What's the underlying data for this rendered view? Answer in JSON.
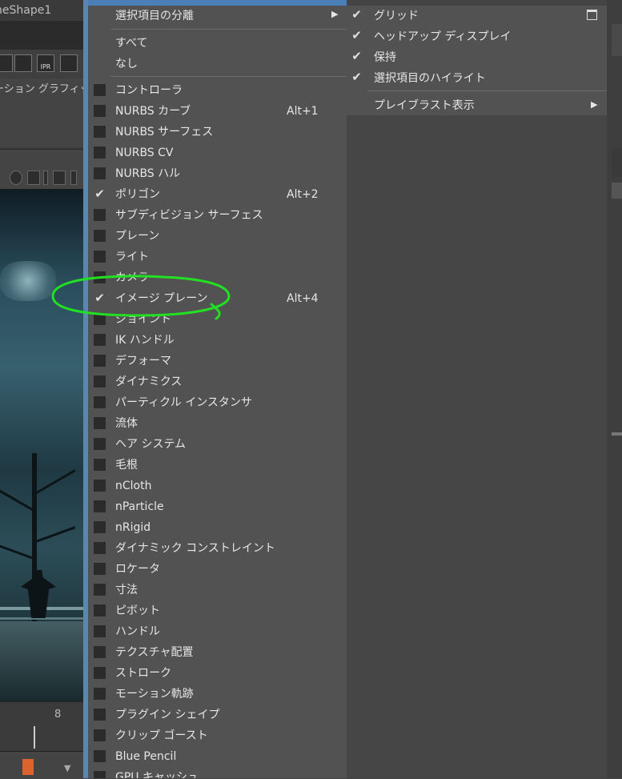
{
  "background": {
    "title_fragment": "neShape1",
    "tabs_fragment": "ーション グラフィック",
    "shelf_label": "IPR",
    "timeline_frame": "8"
  },
  "menu": {
    "isolate": {
      "label": "選択項目の分離"
    },
    "all": {
      "label": "すべて"
    },
    "none": {
      "label": "なし"
    },
    "items": [
      {
        "label": "コントローラ",
        "checked": false,
        "shortcut": ""
      },
      {
        "label": "NURBS カーブ",
        "checked": false,
        "shortcut": "Alt+1"
      },
      {
        "label": "NURBS サーフェス",
        "checked": false,
        "shortcut": ""
      },
      {
        "label": "NURBS CV",
        "checked": false,
        "shortcut": ""
      },
      {
        "label": "NURBS ハル",
        "checked": false,
        "shortcut": ""
      },
      {
        "label": "ポリゴン",
        "checked": true,
        "shortcut": "Alt+2"
      },
      {
        "label": "サブディビジョン サーフェス",
        "checked": false,
        "shortcut": ""
      },
      {
        "label": "プレーン",
        "checked": false,
        "shortcut": ""
      },
      {
        "label": "ライト",
        "checked": false,
        "shortcut": ""
      },
      {
        "label": "カメラ",
        "checked": false,
        "shortcut": ""
      },
      {
        "label": "イメージ プレーン",
        "checked": true,
        "shortcut": "Alt+4"
      },
      {
        "label": "ジョイント",
        "checked": false,
        "shortcut": ""
      },
      {
        "label": "IK ハンドル",
        "checked": false,
        "shortcut": ""
      },
      {
        "label": "デフォーマ",
        "checked": false,
        "shortcut": ""
      },
      {
        "label": "ダイナミクス",
        "checked": false,
        "shortcut": ""
      },
      {
        "label": "パーティクル インスタンサ",
        "checked": false,
        "shortcut": ""
      },
      {
        "label": "流体",
        "checked": false,
        "shortcut": ""
      },
      {
        "label": "ヘア システム",
        "checked": false,
        "shortcut": ""
      },
      {
        "label": "毛根",
        "checked": false,
        "shortcut": ""
      },
      {
        "label": "nCloth",
        "checked": false,
        "shortcut": ""
      },
      {
        "label": "nParticle",
        "checked": false,
        "shortcut": ""
      },
      {
        "label": "nRigid",
        "checked": false,
        "shortcut": ""
      },
      {
        "label": "ダイナミック コンストレイント",
        "checked": false,
        "shortcut": ""
      },
      {
        "label": "ロケータ",
        "checked": false,
        "shortcut": ""
      },
      {
        "label": "寸法",
        "checked": false,
        "shortcut": ""
      },
      {
        "label": "ピボット",
        "checked": false,
        "shortcut": ""
      },
      {
        "label": "ハンドル",
        "checked": false,
        "shortcut": ""
      },
      {
        "label": "テクスチャ配置",
        "checked": false,
        "shortcut": ""
      },
      {
        "label": "ストローク",
        "checked": false,
        "shortcut": ""
      },
      {
        "label": "モーション軌跡",
        "checked": false,
        "shortcut": ""
      },
      {
        "label": "プラグイン シェイプ",
        "checked": false,
        "shortcut": ""
      },
      {
        "label": "クリップ ゴースト",
        "checked": false,
        "shortcut": ""
      },
      {
        "label": "Blue Pencil",
        "checked": false,
        "shortcut": ""
      },
      {
        "label": "GPU キャッシュ",
        "checked": false,
        "shortcut": ""
      }
    ]
  },
  "submenu": {
    "items": [
      {
        "label": "グリッド",
        "checked": true
      },
      {
        "label": "ヘッドアップ ディスプレイ",
        "checked": true
      },
      {
        "label": "保持",
        "checked": true
      },
      {
        "label": "選択項目のハイライト",
        "checked": true
      }
    ],
    "playblast": {
      "label": "プレイブラスト表示"
    }
  },
  "colors": {
    "menu_bg": "#525252",
    "accent_blue": "#4a7fb7",
    "annotation_green": "#22e022"
  }
}
